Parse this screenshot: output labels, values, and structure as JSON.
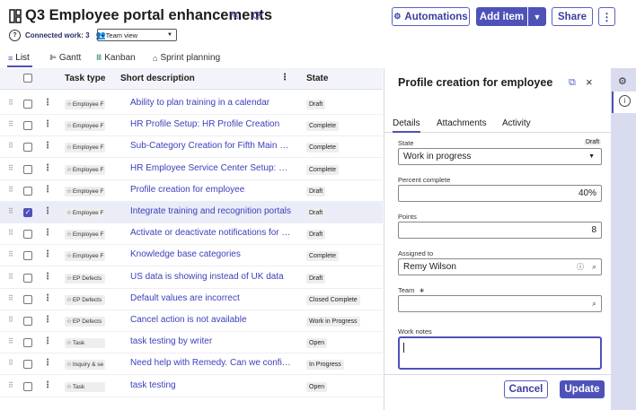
{
  "header": {
    "title": "Q3 Employee portal enhancements",
    "connected_work": "Connected work: 3",
    "view_select": "Team view",
    "automations": "Automations",
    "add_item": "Add item",
    "share": "Share"
  },
  "tabs": [
    "List",
    "Gantt",
    "Kanban",
    "Sprint planning"
  ],
  "table": {
    "headers": {
      "task_type": "Task type",
      "short_description": "Short description",
      "state": "State"
    },
    "rows": [
      {
        "type": "Employee F",
        "desc": "Ability to plan training in a calendar",
        "state": "Draft",
        "selected": false
      },
      {
        "type": "Employee F",
        "desc": "HR Profile Setup: HR Profile Creation",
        "state": "Complete",
        "selected": false
      },
      {
        "type": "Employee F",
        "desc": "Sub-Category Creation for Fifth Main Co...",
        "state": "Complete",
        "selected": false
      },
      {
        "type": "Employee F",
        "desc": "HR Employee Service Center Setup: HR ...",
        "state": "Complete",
        "selected": false
      },
      {
        "type": "Employee F",
        "desc": "Profile creation for employee",
        "state": "Draft",
        "selected": false
      },
      {
        "type": "Employee F",
        "desc": "Integrate training and recognition portals",
        "state": "Draft",
        "selected": true
      },
      {
        "type": "Employee F",
        "desc": "Activate or deactivate notifications for e...",
        "state": "Draft",
        "selected": false
      },
      {
        "type": "Employee F",
        "desc": "Knowledge base categories",
        "state": "Complete",
        "selected": false
      },
      {
        "type": "EP Defects",
        "desc": "US data is showing instead of UK data",
        "state": "Draft",
        "selected": false
      },
      {
        "type": "EP Defects",
        "desc": "Default values are incorrect",
        "state": "Closed Complete",
        "selected": false
      },
      {
        "type": "EP Defects",
        "desc": "Cancel action is not available",
        "state": "Work in Progress",
        "selected": false
      },
      {
        "type": "Task",
        "desc": "task testing by writer",
        "state": "Open",
        "selected": false
      },
      {
        "type": "Inquiry & se",
        "desc": "Need help with Remedy. Can we configu...",
        "state": "In Progress",
        "selected": false
      },
      {
        "type": "Task",
        "desc": "task testing",
        "state": "Open",
        "selected": false
      }
    ]
  },
  "panel": {
    "title": "Profile creation for employee",
    "tabs": [
      "Details",
      "Attachments",
      "Activity"
    ],
    "state_label": "State",
    "state_original": "Draft",
    "state_value": "Work in progress",
    "percent_label": "Percent complete",
    "percent_value": "40%",
    "points_label": "Points",
    "points_value": "8",
    "assigned_label": "Assigned to",
    "assigned_value": "Remy Wilson",
    "team_label": "Team",
    "team_required": "∗",
    "notes_label": "Work notes",
    "cancel": "Cancel",
    "update": "Update"
  },
  "colors": {
    "accent": "#4e52b8",
    "link": "#3b3fbb",
    "rail": "#d9dbef"
  }
}
